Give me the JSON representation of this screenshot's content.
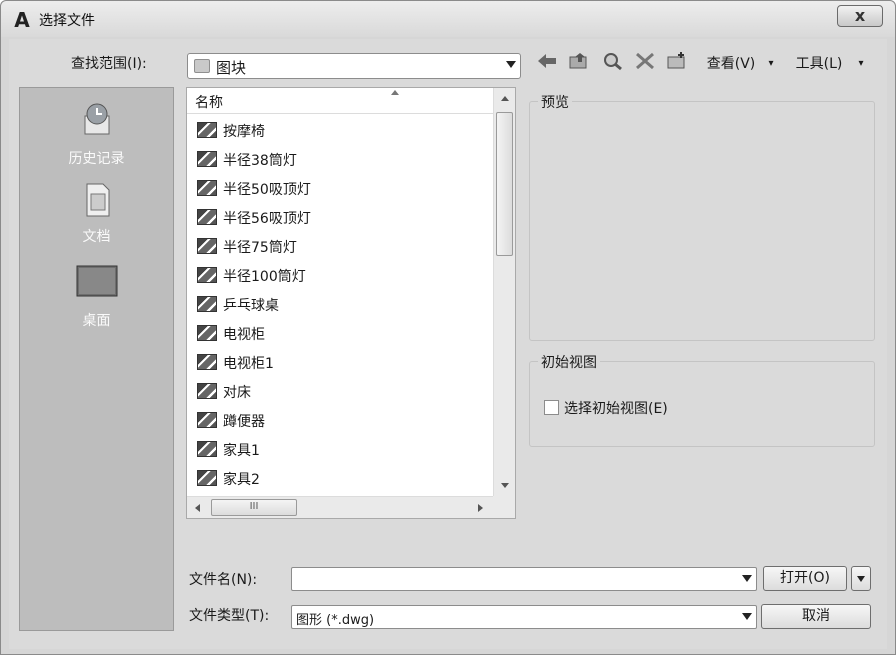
{
  "window": {
    "title": "选择文件",
    "app_icon": "A",
    "close": "x"
  },
  "lookin": {
    "label": "查找范围(I):",
    "value": "图块"
  },
  "toolbar": {
    "back_icon": "arrow-left-icon",
    "up_icon": "folder-up-icon",
    "search_icon": "search-web-icon",
    "delete_icon": "delete-x-icon",
    "newfolder_icon": "new-folder-icon",
    "view_label": "查看(V)",
    "tools_label": "工具(L)"
  },
  "places": [
    {
      "label": "历史记录",
      "icon": "history-icon"
    },
    {
      "label": "文档",
      "icon": "documents-icon"
    },
    {
      "label": "桌面",
      "icon": "desktop-icon"
    }
  ],
  "list": {
    "header": "名称",
    "items": [
      "按摩椅",
      "半径38筒灯",
      "半径50吸顶灯",
      "半径56吸顶灯",
      "半径75筒灯",
      "半径100筒灯",
      "乒乓球桌",
      "电视柜",
      "电视柜1",
      "对床",
      "蹲便器",
      "家具1",
      "家具2"
    ],
    "hscroll_grip": "III"
  },
  "preview": {
    "title": "预览"
  },
  "initial_view": {
    "title": "初始视图",
    "checkbox_label": "选择初始视图(E)",
    "checked": false
  },
  "filename": {
    "label": "文件名(N):",
    "value": ""
  },
  "filetype": {
    "label": "文件类型(T):",
    "value": "图形 (*.dwg)"
  },
  "buttons": {
    "open": "打开(O)",
    "cancel": "取消"
  }
}
